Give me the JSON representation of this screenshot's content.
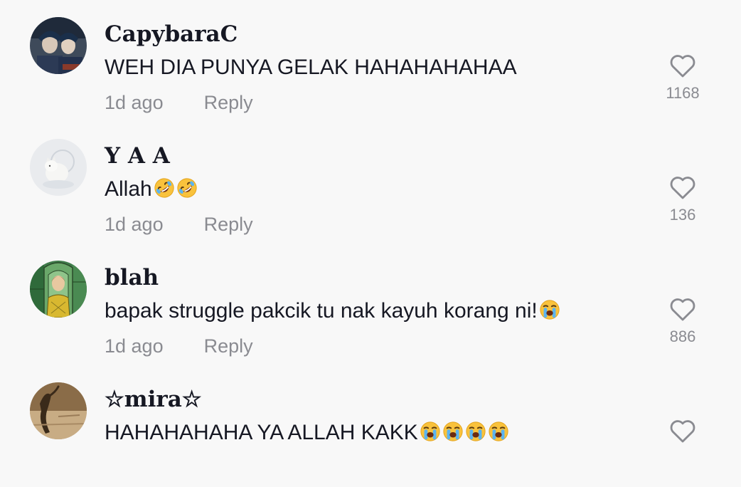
{
  "comments": [
    {
      "username": "CapybaraC",
      "text": "WEH DIA PUNYA GELAK HAHAHAHAHAA",
      "emojis": [],
      "time": "1d ago",
      "reply_label": "Reply",
      "likes": "1168",
      "avatar": "avatar-two-figures"
    },
    {
      "username": "Y A A",
      "text": "Allah",
      "emojis": [
        "rolling-on-floor-laughing",
        "rolling-on-floor-laughing"
      ],
      "time": "1d ago",
      "reply_label": "Reply",
      "likes": "136",
      "avatar": "avatar-white-cat"
    },
    {
      "username": "blah",
      "text": "bapak struggle pakcik tu nak kayuh korang ni!",
      "emojis": [
        "loudly-crying-face"
      ],
      "time": "1d ago",
      "reply_label": "Reply",
      "likes": "886",
      "avatar": "avatar-stained-glass-figure"
    },
    {
      "username": "☆mira☆",
      "text": "HAHAHAHAHA YA ALLAH KAKK",
      "emojis": [
        "loudly-crying-face",
        "loudly-crying-face",
        "loudly-crying-face",
        "loudly-crying-face"
      ],
      "time": "",
      "reply_label": "",
      "likes": "",
      "avatar": "avatar-sepia-dancer"
    }
  ],
  "icons": {
    "like": "heart-outline-icon"
  },
  "colors": {
    "background": "#f8f8f8",
    "primary_text": "#161823",
    "secondary_text": "#8a8b91"
  }
}
